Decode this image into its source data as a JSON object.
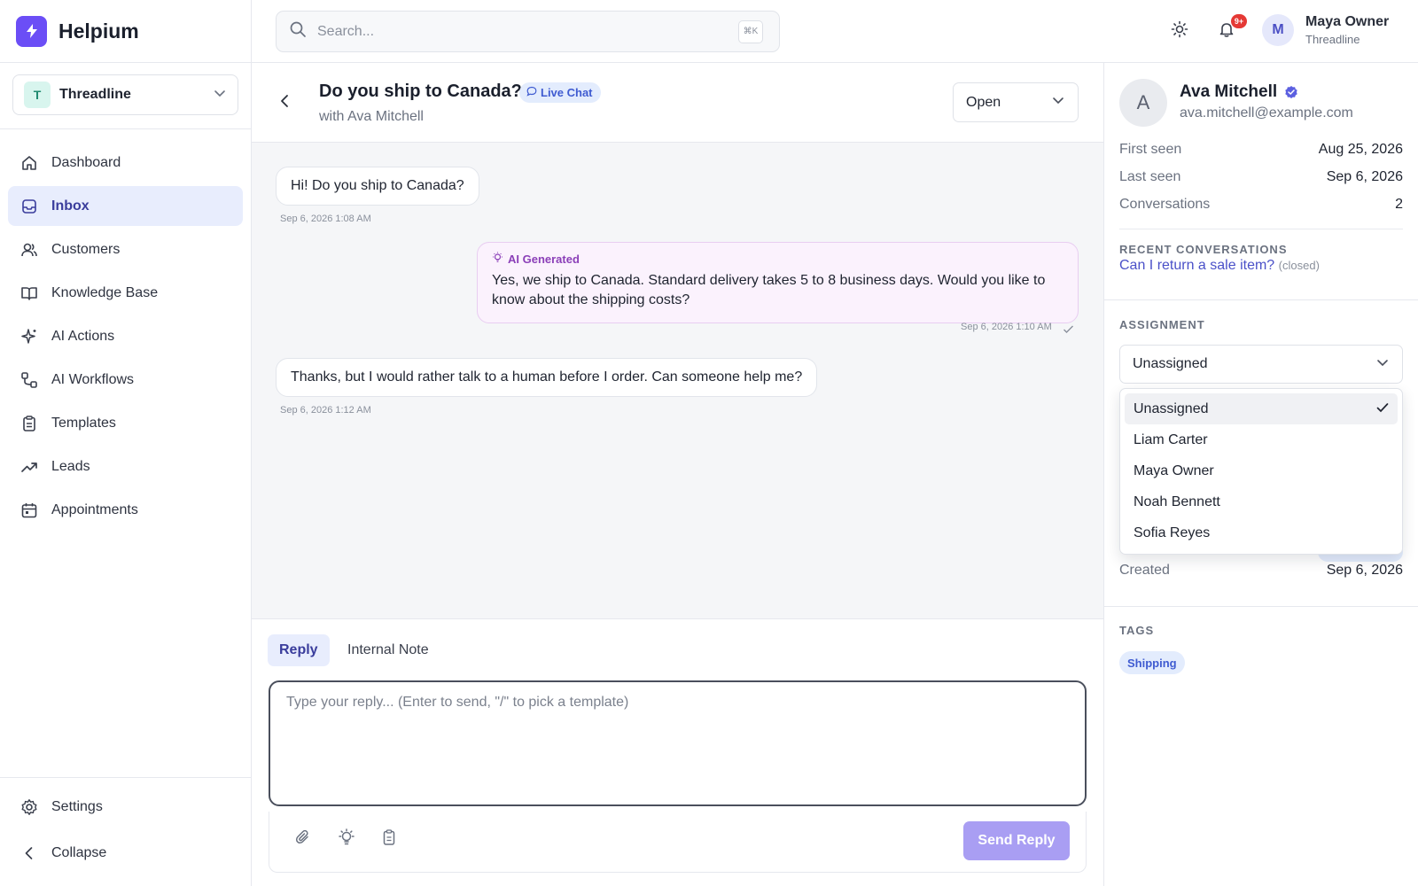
{
  "brand": {
    "name": "Helpium",
    "accent": "#6b4ef6"
  },
  "workspace": {
    "initial": "T",
    "name": "Threadline"
  },
  "nav": [
    {
      "label": "Dashboard",
      "icon": "home-icon"
    },
    {
      "label": "Inbox",
      "icon": "inbox-icon",
      "active": true
    },
    {
      "label": "Customers",
      "icon": "users-icon"
    },
    {
      "label": "Knowledge Base",
      "icon": "book-icon"
    },
    {
      "label": "AI Actions",
      "icon": "sparkles-icon"
    },
    {
      "label": "AI Workflows",
      "icon": "workflow-icon"
    },
    {
      "label": "Templates",
      "icon": "clipboard-icon"
    },
    {
      "label": "Leads",
      "icon": "trending-up-icon"
    },
    {
      "label": "Appointments",
      "icon": "calendar-icon"
    }
  ],
  "footer_nav": {
    "settings": "Settings",
    "collapse": "Collapse"
  },
  "search": {
    "placeholder": "Search...",
    "shortcut": "⌘K"
  },
  "notifications": {
    "count": "9+"
  },
  "user": {
    "initial": "M",
    "name": "Maya Owner",
    "org": "Threadline"
  },
  "conversation": {
    "title": "Do you ship to Canada?",
    "channel": "Live Chat",
    "subtitle": "with Ava Mitchell",
    "status": "Open",
    "messages": [
      {
        "text": "Hi! Do you ship to Canada?",
        "time": "Sep 6, 2026 1:08 AM",
        "from": "customer"
      },
      {
        "label": "AI Generated",
        "text": "Yes, we ship to Canada. Standard delivery takes 5 to 8 business days. Would you like to know about the shipping costs?",
        "time": "Sep 6, 2026 1:10 AM",
        "from": "ai"
      },
      {
        "text": "Thanks, but I would rather talk to a human before I order. Can someone help me?",
        "time": "Sep 6, 2026 1:12 AM",
        "from": "customer"
      }
    ]
  },
  "composer": {
    "tabs": [
      "Reply",
      "Internal Note"
    ],
    "placeholder": "Type your reply... (Enter to send, \"/\" to pick a template)",
    "send_label": "Send Reply"
  },
  "customer": {
    "initial": "A",
    "name": "Ava Mitchell",
    "email": "ava.mitchell@example.com",
    "first_seen_label": "First seen",
    "first_seen": "Aug 25, 2026",
    "last_seen_label": "Last seen",
    "last_seen": "Sep 6, 2026",
    "conversations_label": "Conversations",
    "conversations": "2"
  },
  "recent": {
    "title": "RECENT CONVERSATIONS",
    "items": [
      {
        "subject": "Can I return a sale item?",
        "state": "(closed)"
      }
    ]
  },
  "assignment": {
    "title": "ASSIGNMENT",
    "selected": "Unassigned",
    "options": [
      "Unassigned",
      "Liam Carter",
      "Maya Owner",
      "Noah Bennett",
      "Sofia Reyes"
    ]
  },
  "details": {
    "created_label": "Created",
    "created": "Sep 6, 2026"
  },
  "tags": {
    "title": "TAGS",
    "items": [
      "Shipping"
    ]
  }
}
